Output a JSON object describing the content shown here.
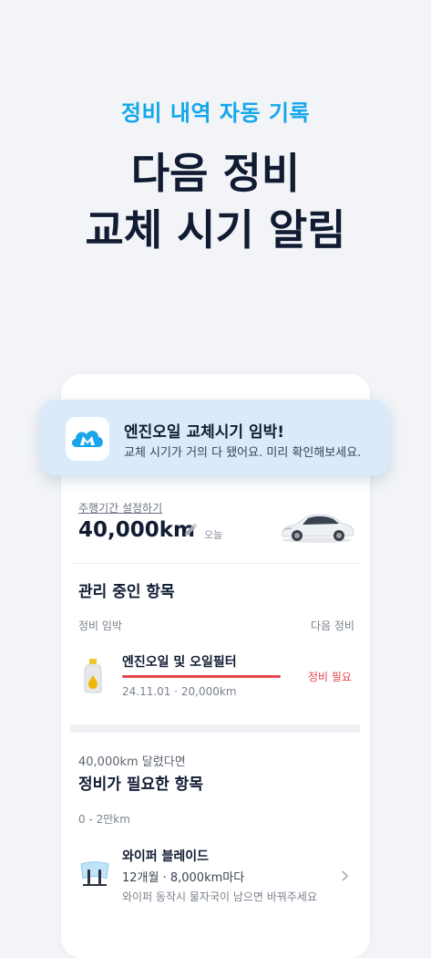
{
  "hero": {
    "subtitle": "정비 내역 자동 기록",
    "line1": "다음 정비",
    "line2": "교체 시기 알림"
  },
  "notification": {
    "app_icon": "car-cloud-app-icon",
    "title": "엔진오일 교체시기 임박!",
    "body": "교체 시기가 거의 다 됐어요. 미리 확인해보세요."
  },
  "vehicle": {
    "setting_link": "주행기간 설정하기",
    "odometer": "40,000km",
    "date_label": "오늘",
    "edit_icon": "pencil-icon",
    "car_image": "white-sedan"
  },
  "managed": {
    "title": "관리 중인 항목",
    "col_left": "정비 임박",
    "col_right": "다음 정비",
    "item": {
      "icon": "oil-bottle-icon",
      "name": "엔진오일 및 오일필터",
      "meta": "24.11.01 · 20,000km",
      "status": "정비 필요",
      "progress": 1.0,
      "status_color": "#e5484d"
    }
  },
  "needed": {
    "caption": "40,000km 달렸다면",
    "title": "정비가 필요한 항목",
    "range": "0 - 2만km",
    "item": {
      "icon": "wiper-icon",
      "name": "와이퍼 블레이드",
      "interval": "12개월 · 8,000km마다",
      "desc": "와이퍼 동작시 물자국이 남으면 바꿔주세요"
    }
  },
  "colors": {
    "accent": "#15a7ea",
    "headline": "#111c33",
    "notification_bg": "#d9ebfa",
    "danger": "#e5484d"
  }
}
